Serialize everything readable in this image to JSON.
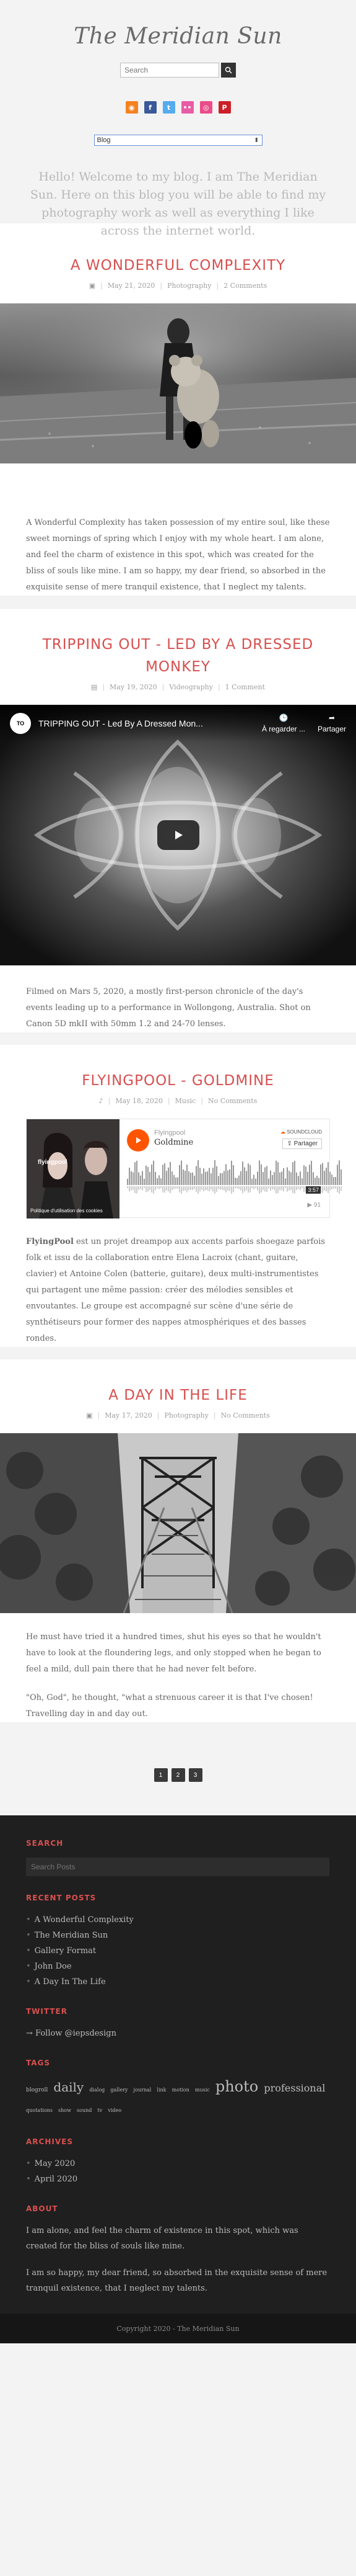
{
  "site": {
    "title": "The Meridian Sun",
    "search_placeholder": "Search",
    "nav_selected": "Blog",
    "intro": "Hello! Welcome to my blog. I am The Meridian Sun. Here on this blog you will be able to find my photography work as well as everything I like across the internet world."
  },
  "social": [
    {
      "icon": "rss-icon",
      "glyph": "◉",
      "color": "#f58220"
    },
    {
      "icon": "facebook-icon",
      "glyph": "f",
      "color": "#3b5998"
    },
    {
      "icon": "twitter-icon",
      "glyph": "t",
      "color": "#55acee"
    },
    {
      "icon": "flickr-icon",
      "glyph": "••",
      "color": "#e85ca6"
    },
    {
      "icon": "dribbble-icon",
      "glyph": "◎",
      "color": "#ea4c89"
    },
    {
      "icon": "pinterest-icon",
      "glyph": "P",
      "color": "#cb2027"
    }
  ],
  "posts": [
    {
      "title": "A Wonderful Complexity",
      "date": "May 21, 2020",
      "category": "Photography",
      "comments": "2 Comments",
      "body": "A Wonderful Complexity has taken possession of my entire soul, like these sweet mornings of spring which I enjoy with my whole heart. I am alone, and feel the charm of existence in this spot, which was created for the bliss of souls like mine. I am so happy, my dear friend, so absorbed in the exquisite sense of mere tranquil existence, that I neglect my talents."
    },
    {
      "title": "Tripping Out - Led by a Dressed Monkey",
      "date": "May 19, 2020",
      "category": "Videography",
      "comments": "1 Comment",
      "body": "Filmed on Mars 5, 2020, a mostly first-person chronicle of the day's events leading up to a performance in Wollongong, Australia. Shot on Canon 5D mkII with 50mm 1.2 and 24-70 lenses.",
      "video_title": "TRIPPING OUT - Led By A Dressed Mon...",
      "video_watch_later": "À regarder ...",
      "video_share": "Partager"
    },
    {
      "title": "Flyingpool - Goldmine",
      "date": "May 18, 2020",
      "category": "Music",
      "comments": "No Comments",
      "body_bold": "FlyingPool",
      "body": " est un projet dreampop aux accents parfois shoegaze parfois folk et issu de la collaboration entre Elena Lacroix (chant, guitare, clavier) et Antoine Colen (batterie, guitare), deux multi-instrumentistes qui partagent une même passion: créer des mélodies sensibles et envoutantes. Le groupe est accompagné sur scène d'une série de synthétiseurs pour former des nappes atmosphériques et des basses rondes.",
      "sc_artist": "Flyingpool",
      "sc_track": "Goldmine",
      "sc_logo": "SOUNDCLOUD",
      "sc_share": "Partager",
      "sc_time": "3:57",
      "sc_policy": "Politique d'utilisation des cookies",
      "sc_plays": "91",
      "sc_art_label": "flyingpool"
    },
    {
      "title": "A Day In The Life",
      "date": "May 17, 2020",
      "category": "Photography",
      "comments": "No Comments",
      "body": "He must have tried it a hundred times, shut his eyes so that he wouldn't have to look at the floundering legs, and only stopped when he began to feel a mild, dull pain there that he had never felt before.",
      "body2": "\"Oh, God\", he thought, \"what a strenuous career it is that I've chosen! Travelling day in and day out."
    }
  ],
  "pagination": [
    "1",
    "2",
    "3"
  ],
  "footer": {
    "search_title": "Search",
    "search_placeholder": "Search Posts",
    "recent_title": "Recent Posts",
    "recent": [
      "A Wonderful Complexity",
      "The Meridian Sun",
      "Gallery Format",
      "John Doe",
      "A Day In The Life"
    ],
    "twitter_title": "Twitter",
    "twitter_follow": "→ Follow @iepsdesign",
    "tags_title": "Tags",
    "tags": [
      {
        "t": "blogroll",
        "s": 9
      },
      {
        "t": "daily",
        "s": 20
      },
      {
        "t": "dialog",
        "s": 8
      },
      {
        "t": "gallery",
        "s": 8
      },
      {
        "t": "journal",
        "s": 8
      },
      {
        "t": "link",
        "s": 8
      },
      {
        "t": "motion",
        "s": 8
      },
      {
        "t": "music",
        "s": 8
      },
      {
        "t": "photo",
        "s": 24
      },
      {
        "t": "professional",
        "s": 16
      },
      {
        "t": "quotations",
        "s": 8
      },
      {
        "t": "show",
        "s": 8
      },
      {
        "t": "sound",
        "s": 8
      },
      {
        "t": "tv",
        "s": 8
      },
      {
        "t": "video",
        "s": 8
      }
    ],
    "archives_title": "Archives",
    "archives": [
      "May 2020",
      "April 2020"
    ],
    "about_title": "About",
    "about1": "I am alone, and feel the charm of existence in this spot, which was created for the bliss of souls like mine.",
    "about2": "I am so happy, my dear friend, so absorbed in the exquisite sense of mere tranquil existence, that I neglect my talents.",
    "copyright": "Copyright 2020 - The Meridian Sun"
  }
}
